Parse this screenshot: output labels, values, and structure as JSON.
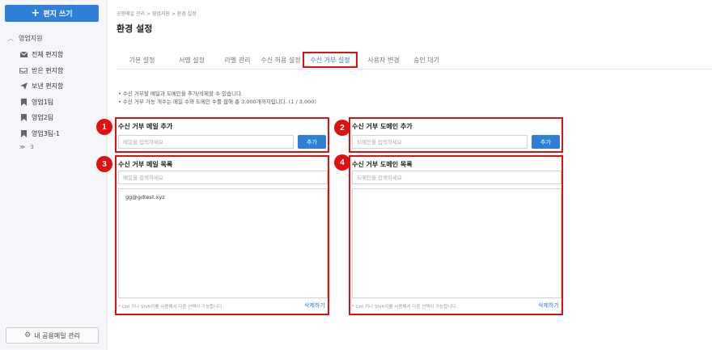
{
  "sidebar": {
    "compose_label": "편지 쓰기",
    "group_label": "영업지원",
    "items": [
      {
        "label": "전체 편지함",
        "icon": "envelope-icon"
      },
      {
        "label": "받은 편지함",
        "icon": "inbox-icon"
      },
      {
        "label": "보낸 편지함",
        "icon": "paper-plane-icon"
      },
      {
        "label": "영업1팀",
        "icon": "bookmark-icon"
      },
      {
        "label": "영업2팀",
        "icon": "bookmark-icon"
      },
      {
        "label": "영업3팀-1",
        "icon": "bookmark-icon"
      }
    ],
    "more_count": "3",
    "shared_button_label": "내 공용메일 관리"
  },
  "header": {
    "breadcrumb": "공용메일 관리 > 영업지원 > 환경 설정",
    "title": "환경 설정"
  },
  "tabs": [
    {
      "label": "기본 설정",
      "active": false
    },
    {
      "label": "서명 설정",
      "active": false
    },
    {
      "label": "라벨 관리",
      "active": false
    },
    {
      "label": "수신 허용 설정",
      "active": false
    },
    {
      "label": "수신 거부 설정",
      "active": true
    },
    {
      "label": "사용자 변경",
      "active": false
    },
    {
      "label": "승인 대기",
      "active": false
    }
  ],
  "notes": [
    "수신 거부할 메일과 도메인을 추가/삭제할 수 있습니다.",
    "수신 거부 가능 개수는 메일 수와 도메인 수를 합해 총 3,000개까지입니다. (1 / 3,000)"
  ],
  "panels": {
    "add_email": {
      "badge": "1",
      "title": "수신 거부 메일 추가",
      "placeholder": "메일을 입력하세요",
      "button_label": "추가"
    },
    "add_domain": {
      "badge": "2",
      "title": "수신 거부 도메인 추가",
      "placeholder": "도메인을 입력하세요",
      "button_label": "추가"
    },
    "email_list": {
      "badge": "3",
      "title": "수신 거부 메일 목록",
      "search_placeholder": "메일을 검색하세요",
      "entries": [
        "gg@gdtest.xyz"
      ],
      "hint": "* Ctrl 키나 Shift키를 사용해서 다중 선택이 가능합니다.",
      "delete_label": "삭제하기"
    },
    "domain_list": {
      "badge": "4",
      "title": "수신 거부 도메인 목록",
      "search_placeholder": "도메인을 검색하세요",
      "entries": [],
      "hint": "* Ctrl 키나 Shift키를 사용해서 다중 선택이 가능합니다.",
      "delete_label": "삭제하기"
    }
  },
  "colors": {
    "accent": "#2f7fd8",
    "highlight": "#e01010"
  }
}
